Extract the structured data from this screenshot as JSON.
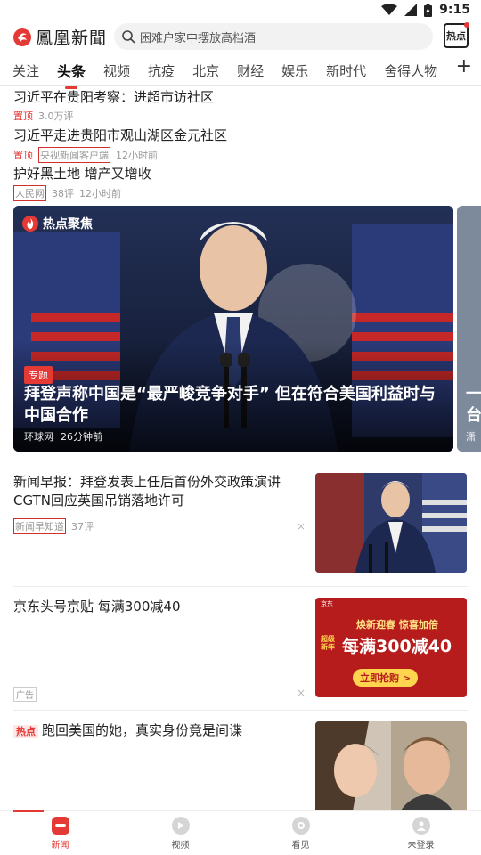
{
  "status": {
    "time": "9:15"
  },
  "brand": {
    "logo_text": "鳳凰新聞",
    "color": "#e53935"
  },
  "search": {
    "placeholder": "困难户家中摆放高档酒"
  },
  "hot_button": {
    "label": "热点"
  },
  "tabs": [
    {
      "label": "关注",
      "active": false
    },
    {
      "label": "头条",
      "active": true
    },
    {
      "label": "视频",
      "active": false
    },
    {
      "label": "抗疫",
      "active": false
    },
    {
      "label": "北京",
      "active": false
    },
    {
      "label": "财经",
      "active": false
    },
    {
      "label": "娱乐",
      "active": false
    },
    {
      "label": "新时代",
      "active": false
    },
    {
      "label": "舍得人物",
      "active": false
    }
  ],
  "tab_add": "+",
  "pinned": [
    {
      "title": "习近平在贵阳考察：进超市访社区",
      "tag": "置顶",
      "meta1": "3.0万评"
    },
    {
      "title": "习近平走进贵阳市观山湖区金元社区",
      "tag": "置顶",
      "source": "央视新闻客户端",
      "time": "12小时前"
    },
    {
      "title": "护好黑土地 增产又增收",
      "source": "人民网",
      "comments": "38评",
      "time": "12小时前"
    }
  ],
  "hero": {
    "badge": "热点聚焦",
    "tag": "专题",
    "title": "拜登声称中国是“最严峻竞争对手” 但在符合美国利益时与中国合作",
    "source": "环球网",
    "time": "26分钟前",
    "next_title": "一\n台",
    "next_meta": "潇"
  },
  "news": [
    {
      "title": "新闻早报：拜登发表上任后首份外交政策演讲 CGTN回应英国吊销落地许可",
      "source": "新闻早知道",
      "comments": "37评",
      "close": "×"
    },
    {
      "title": "京东头号京贴 每满300减40",
      "ad_label": "广告",
      "close": "×",
      "ad_banner_line1": "焕新迎春 惊喜加倍",
      "ad_banner_line2": "每满300减40",
      "ad_banner_cta": "立即抢购 >",
      "ad_banner_small": "京东",
      "ad_banner_badge": "超级\n新年"
    },
    {
      "hot_tag": "热点",
      "title": "跑回美国的她，真实身份竟是间谍"
    }
  ],
  "bottom_nav": [
    {
      "label": "新闻",
      "active": true
    },
    {
      "label": "视频",
      "active": false
    },
    {
      "label": "看见",
      "active": false
    },
    {
      "label": "未登录",
      "active": false
    }
  ]
}
